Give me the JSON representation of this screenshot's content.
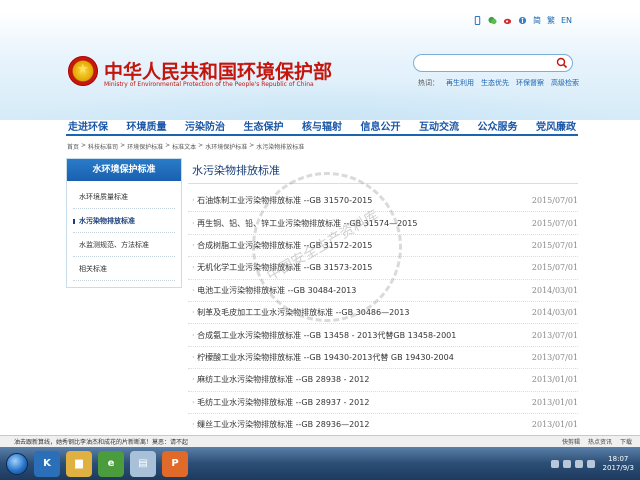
{
  "browser": {
    "top_links": [
      "简",
      "繁",
      "EN"
    ]
  },
  "header": {
    "title": "中华人民共和国环境保护部",
    "subtitle": "Ministry of Environmental Protection of the People's Republic of China",
    "search": {
      "value": "",
      "placeholder": ""
    },
    "hot_label": "热词：",
    "hot_words": [
      "再生利用",
      "生态优先",
      "环保督察",
      "高级检索"
    ]
  },
  "nav": [
    "走进环保",
    "环境质量",
    "污染防治",
    "生态保护",
    "核与辐射",
    "信息公开",
    "互动交流",
    "公众服务",
    "党风廉政"
  ],
  "breadcrumb": [
    "首页",
    "科技标准司",
    "环境保护标准",
    "标准文本",
    "水环境保护标准",
    "水污染物排放标准"
  ],
  "breadcrumb_sep": ">",
  "sidebar": {
    "title": "水环境保护标准",
    "items": [
      {
        "label": "水环境质量标准"
      },
      {
        "label": "水污染物排放标准"
      },
      {
        "label": "水监测规范、方法标准"
      },
      {
        "label": "相关标准"
      }
    ]
  },
  "content": {
    "title": "水污染物排放标准",
    "items": [
      {
        "title": "石油炼制工业污染物排放标准 --GB 31570-2015",
        "date": "2015/07/01"
      },
      {
        "title": "再生铜、铝、铅、锌工业污染物排放标准 --GB 31574—2015",
        "date": "2015/07/01"
      },
      {
        "title": "合成树脂工业污染物排放标准 --GB 31572-2015",
        "date": "2015/07/01"
      },
      {
        "title": "无机化学工业污染物排放标准 --GB 31573-2015",
        "date": "2015/07/01"
      },
      {
        "title": "电池工业污染物排放标准 --GB 30484-2013",
        "date": "2014/03/01"
      },
      {
        "title": "制革及毛皮加工工业水污染物排放标准 --GB 30486—2013",
        "date": "2014/03/01"
      },
      {
        "title": "合成氨工业水污染物排放标准 --GB 13458 - 2013代替GB 13458-2001",
        "date": "2013/07/01"
      },
      {
        "title": "柠檬酸工业水污染物排放标准 --GB 19430-2013代替 GB 19430-2004",
        "date": "2013/07/01"
      },
      {
        "title": "麻纺工业水污染物排放标准 --GB 28938 - 2012",
        "date": "2013/01/01"
      },
      {
        "title": "毛纺工业水污染物排放标准 --GB 28937 - 2012",
        "date": "2013/01/01"
      },
      {
        "title": "缫丝工业水污染物排放标准 --GB 28936—2012",
        "date": "2013/01/01"
      }
    ]
  },
  "watermark": "中国安全生产资料库",
  "status_bar": {
    "message": "油去跟新算线，她秀钢比李油杰和成花的片新断离！莫恶：请不起",
    "items": [
      "快剪辑",
      "热点资讯",
      "下载"
    ]
  },
  "taskbar": {
    "apps": [
      {
        "label": "K",
        "color": "#2a6fb8"
      },
      {
        "label": "",
        "color": "#e0b040"
      },
      {
        "label": "",
        "color": "#4a9c3c"
      },
      {
        "label": "",
        "color": "#a8c0d8"
      },
      {
        "label": "P",
        "color": "#e06a2a"
      }
    ],
    "time": "18:07",
    "date": "2017/9/3"
  }
}
